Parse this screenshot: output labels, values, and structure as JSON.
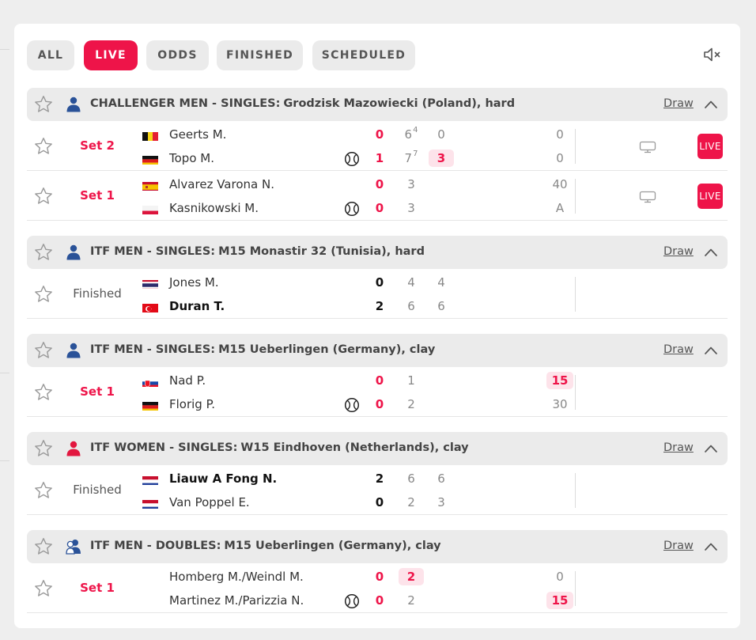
{
  "filters": [
    {
      "label": "ALL",
      "active": false
    },
    {
      "label": "LIVE",
      "active": true
    },
    {
      "label": "ODDS",
      "active": false
    },
    {
      "label": "FINISHED",
      "active": false
    },
    {
      "label": "SCHEDULED",
      "active": false
    }
  ],
  "icons": {
    "mute": "speaker-mute-icon",
    "favorite": "star-icon",
    "serve": "tennis-ball-icon",
    "tv": "tv-icon",
    "collapse": "chevron-up-icon"
  },
  "colors": {
    "accent": "#ee1449",
    "men": "#2a5298",
    "women": "#e2173f"
  },
  "sections": [
    {
      "category": "CHALLENGER MEN - SINGLES:",
      "tournament": "Grodzisk Mazowiecki (Poland), hard",
      "gender": "men",
      "draw": "Draw",
      "matches": [
        {
          "status": "Set 2",
          "live": true,
          "tv": true,
          "live_badge": "LIVE",
          "players": [
            {
              "flag": "be",
              "name": "Geerts M.",
              "serve": false,
              "total": "0",
              "sets": [
                {
                  "v": "6",
                  "tb": "4"
                },
                {
                  "v": "0"
                }
              ],
              "points": "0"
            },
            {
              "flag": "de",
              "name": "Topo M.",
              "serve": true,
              "total": "1",
              "sets": [
                {
                  "v": "7",
                  "tb": "7"
                },
                {
                  "v": "3",
                  "cur": true
                }
              ],
              "points": "0"
            }
          ]
        },
        {
          "status": "Set 1",
          "live": true,
          "tv": true,
          "live_badge": "LIVE",
          "players": [
            {
              "flag": "es",
              "name": "Alvarez Varona N.",
              "serve": false,
              "total": "0",
              "sets": [
                {
                  "v": "3"
                }
              ],
              "points": "40"
            },
            {
              "flag": "pl",
              "name": "Kasnikowski M.",
              "serve": true,
              "total": "0",
              "sets": [
                {
                  "v": "3"
                }
              ],
              "points": "A"
            }
          ]
        }
      ]
    },
    {
      "category": "ITF MEN - SINGLES:",
      "tournament": "M15 Monastir 32 (Tunisia), hard",
      "gender": "men",
      "draw": "Draw",
      "matches": [
        {
          "status": "Finished",
          "live": false,
          "tv": false,
          "players": [
            {
              "flag": "th",
              "name": "Jones M.",
              "serve": false,
              "winner": false,
              "total": "0",
              "sets": [
                {
                  "v": "4"
                },
                {
                  "v": "4"
                }
              ],
              "points": ""
            },
            {
              "flag": "tr",
              "name": "Duran T.",
              "serve": false,
              "winner": true,
              "total": "2",
              "sets": [
                {
                  "v": "6"
                },
                {
                  "v": "6"
                }
              ],
              "points": ""
            }
          ]
        }
      ]
    },
    {
      "category": "ITF MEN - SINGLES:",
      "tournament": "M15 Ueberlingen (Germany), clay",
      "gender": "men",
      "draw": "Draw",
      "matches": [
        {
          "status": "Set 1",
          "live": true,
          "tv": false,
          "players": [
            {
              "flag": "sk",
              "name": "Nad P.",
              "serve": false,
              "total": "0",
              "sets": [
                {
                  "v": "1"
                }
              ],
              "points": "15",
              "points_cur": true
            },
            {
              "flag": "de",
              "name": "Florig P.",
              "serve": true,
              "total": "0",
              "sets": [
                {
                  "v": "2"
                }
              ],
              "points": "30"
            }
          ]
        }
      ]
    },
    {
      "category": "ITF WOMEN - SINGLES:",
      "tournament": "W15 Eindhoven (Netherlands), clay",
      "gender": "women",
      "draw": "Draw",
      "matches": [
        {
          "status": "Finished",
          "live": false,
          "tv": false,
          "players": [
            {
              "flag": "nl",
              "name": "Liauw A Fong N.",
              "serve": false,
              "winner": true,
              "total": "2",
              "sets": [
                {
                  "v": "6"
                },
                {
                  "v": "6"
                }
              ],
              "points": ""
            },
            {
              "flag": "nl",
              "name": "Van Poppel E.",
              "serve": false,
              "winner": false,
              "total": "0",
              "sets": [
                {
                  "v": "2"
                },
                {
                  "v": "3"
                }
              ],
              "points": ""
            }
          ]
        }
      ]
    },
    {
      "category": "ITF MEN - DOUBLES:",
      "tournament": "M15 Ueberlingen (Germany), clay",
      "gender": "doubles",
      "draw": "Draw",
      "matches": [
        {
          "status": "Set 1",
          "live": true,
          "tv": false,
          "players": [
            {
              "flag": "",
              "name": "Homberg M./Weindl M.",
              "serve": false,
              "total": "0",
              "sets": [
                {
                  "v": "2",
                  "cur": true
                }
              ],
              "points": "0"
            },
            {
              "flag": "",
              "name": "Martinez M./Parizzia N.",
              "serve": true,
              "total": "0",
              "sets": [
                {
                  "v": "2"
                }
              ],
              "points": "15",
              "points_cur": true
            }
          ]
        }
      ]
    }
  ]
}
